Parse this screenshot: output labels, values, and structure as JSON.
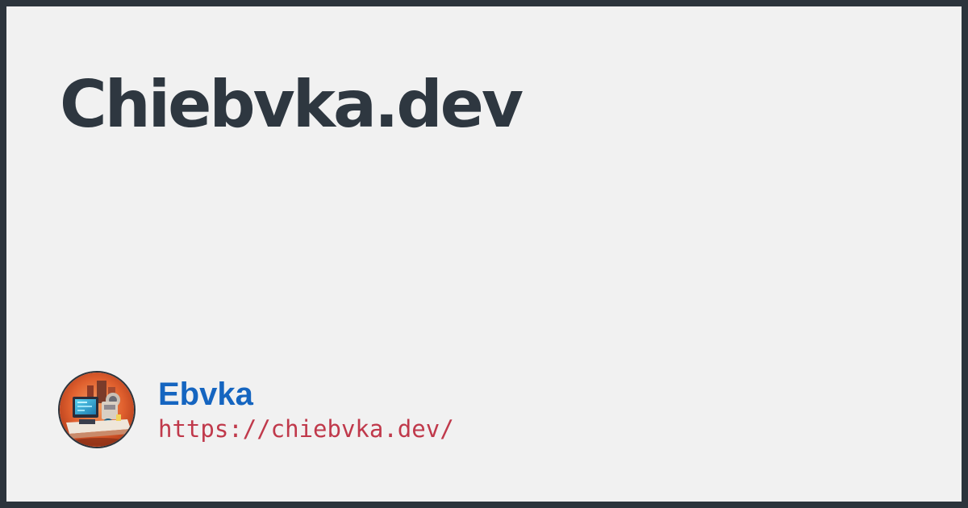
{
  "card": {
    "title": "Chiebvka.dev"
  },
  "author": {
    "avatar_icon": "robot-workshop-avatar-icon",
    "name": "Ebvka",
    "url": "https://chiebvka.dev/"
  },
  "colors": {
    "frame": "#2c343c",
    "background": "#f1f1f1",
    "title": "#2e3740",
    "name": "#1565c0",
    "url": "#c0394b"
  }
}
